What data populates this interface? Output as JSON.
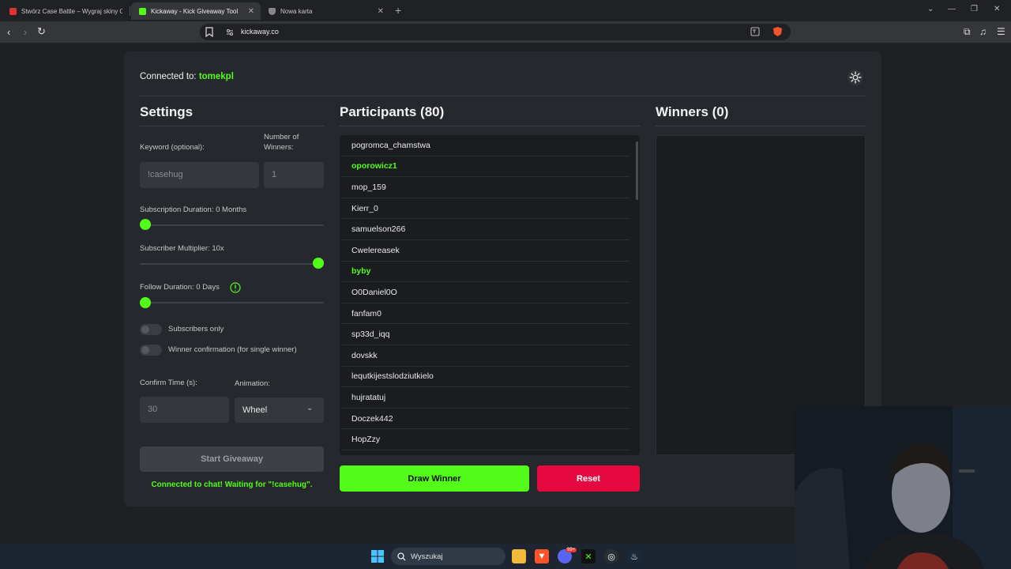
{
  "browser": {
    "tabs": [
      {
        "title": "Stwórz Case Battle – Wygraj skiny CS",
        "active": false
      },
      {
        "title": "Kickaway - Kick Giveaway Tool",
        "active": true
      },
      {
        "title": "Nowa karta",
        "active": false
      }
    ],
    "url": "kickaway.co"
  },
  "header": {
    "connected_label": "Connected to:",
    "channel": "tomekpl"
  },
  "settings": {
    "title": "Settings",
    "keyword_label": "Keyword (optional):",
    "keyword_value": "!casehug",
    "winners_label": "Number of Winners:",
    "winners_value": "1",
    "sub_duration_label": "Subscription Duration: 0 Months",
    "sub_duration_level": 0,
    "sub_multiplier_label": "Subscriber Multiplier: 10x",
    "sub_multiplier_level": 1,
    "follow_duration_label": "Follow Duration:  0  Days",
    "follow_duration_level": 0,
    "subscribers_only_label": "Subscribers only",
    "winner_confirmation_label": "Winner confirmation (for single winner)",
    "confirm_time_label": "Confirm Time (s):",
    "confirm_time_value": "30",
    "animation_label": "Animation:",
    "animation_value": "Wheel",
    "start_button": "Start Giveaway",
    "status": "Connected to chat! Waiting for \"!casehug\"."
  },
  "participants": {
    "title": "Participants (80)",
    "names": [
      {
        "name": "pogromca_chamstwa",
        "highlight": false
      },
      {
        "name": "oporowicz1",
        "highlight": true
      },
      {
        "name": "mop_159",
        "highlight": false
      },
      {
        "name": "Kierr_0",
        "highlight": false
      },
      {
        "name": "samuelson266",
        "highlight": false
      },
      {
        "name": "Cwelereasek",
        "highlight": false
      },
      {
        "name": "byby",
        "highlight": true
      },
      {
        "name": "O0Daniel0O",
        "highlight": false
      },
      {
        "name": "fanfam0",
        "highlight": false
      },
      {
        "name": "sp33d_iqq",
        "highlight": false
      },
      {
        "name": "dovskk",
        "highlight": false
      },
      {
        "name": "lequtkijestslodziutkielo",
        "highlight": false
      },
      {
        "name": "hujratatuj",
        "highlight": false
      },
      {
        "name": "Doczek442",
        "highlight": false
      },
      {
        "name": "HopZzy",
        "highlight": false
      }
    ],
    "draw_button": "Draw Winner",
    "reset_button": "Reset"
  },
  "winners": {
    "title": "Winners (0)"
  },
  "taskbar": {
    "search_placeholder": "Wyszukaj",
    "badge": "99+"
  },
  "colors": {
    "accent": "#53fc18",
    "reset": "#e6093f",
    "panel": "#25282c"
  }
}
